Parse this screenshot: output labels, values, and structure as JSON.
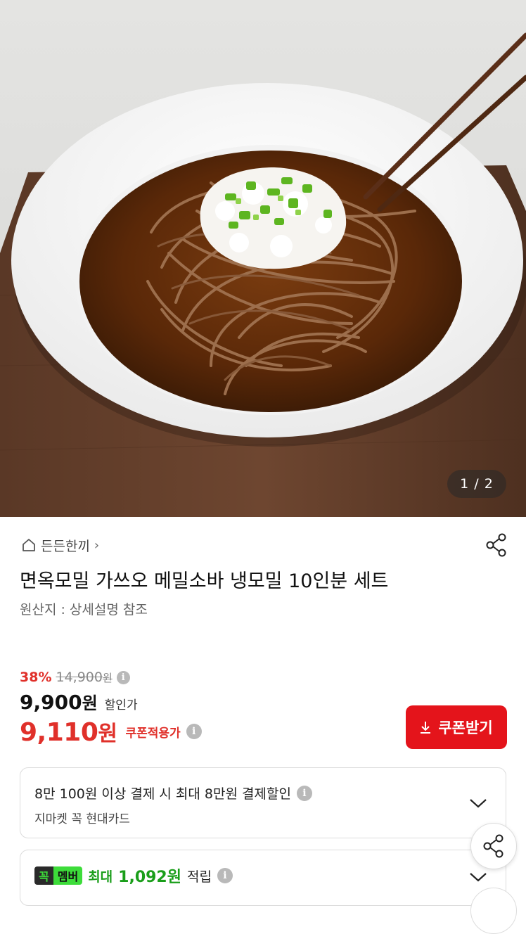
{
  "gallery": {
    "counter": "1 / 2"
  },
  "seller": {
    "name": "든든한끼",
    "chevron": "›"
  },
  "product": {
    "title": "면옥모밀 가쓰오 메밀소바 냉모밀 10인분 세트",
    "origin": "원산지 : 상세설명 참조"
  },
  "price": {
    "discount_rate": "38%",
    "original": "14,900",
    "original_unit": "원",
    "sale": "9,900",
    "sale_unit": "원",
    "sale_label": "할인가",
    "coupon_price": "9,110",
    "coupon_unit": "원",
    "coupon_label": "쿠폰적용가"
  },
  "coupon_button": {
    "label": "쿠폰받기",
    "icon": "download-arrow-icon"
  },
  "payment_card": {
    "line1": "8만 100원 이상 결제 시 최대 8만원 결제할인",
    "line2": "지마켓 꼭 현대카드"
  },
  "member_card": {
    "badge_part1": "꼭",
    "badge_part2": "멤버",
    "label": "최대",
    "amount": "1,092원",
    "suffix": "적립"
  },
  "colors": {
    "accent_red": "#e4141b",
    "sale_red": "#e0302a",
    "member_green": "#3ddc3a"
  }
}
